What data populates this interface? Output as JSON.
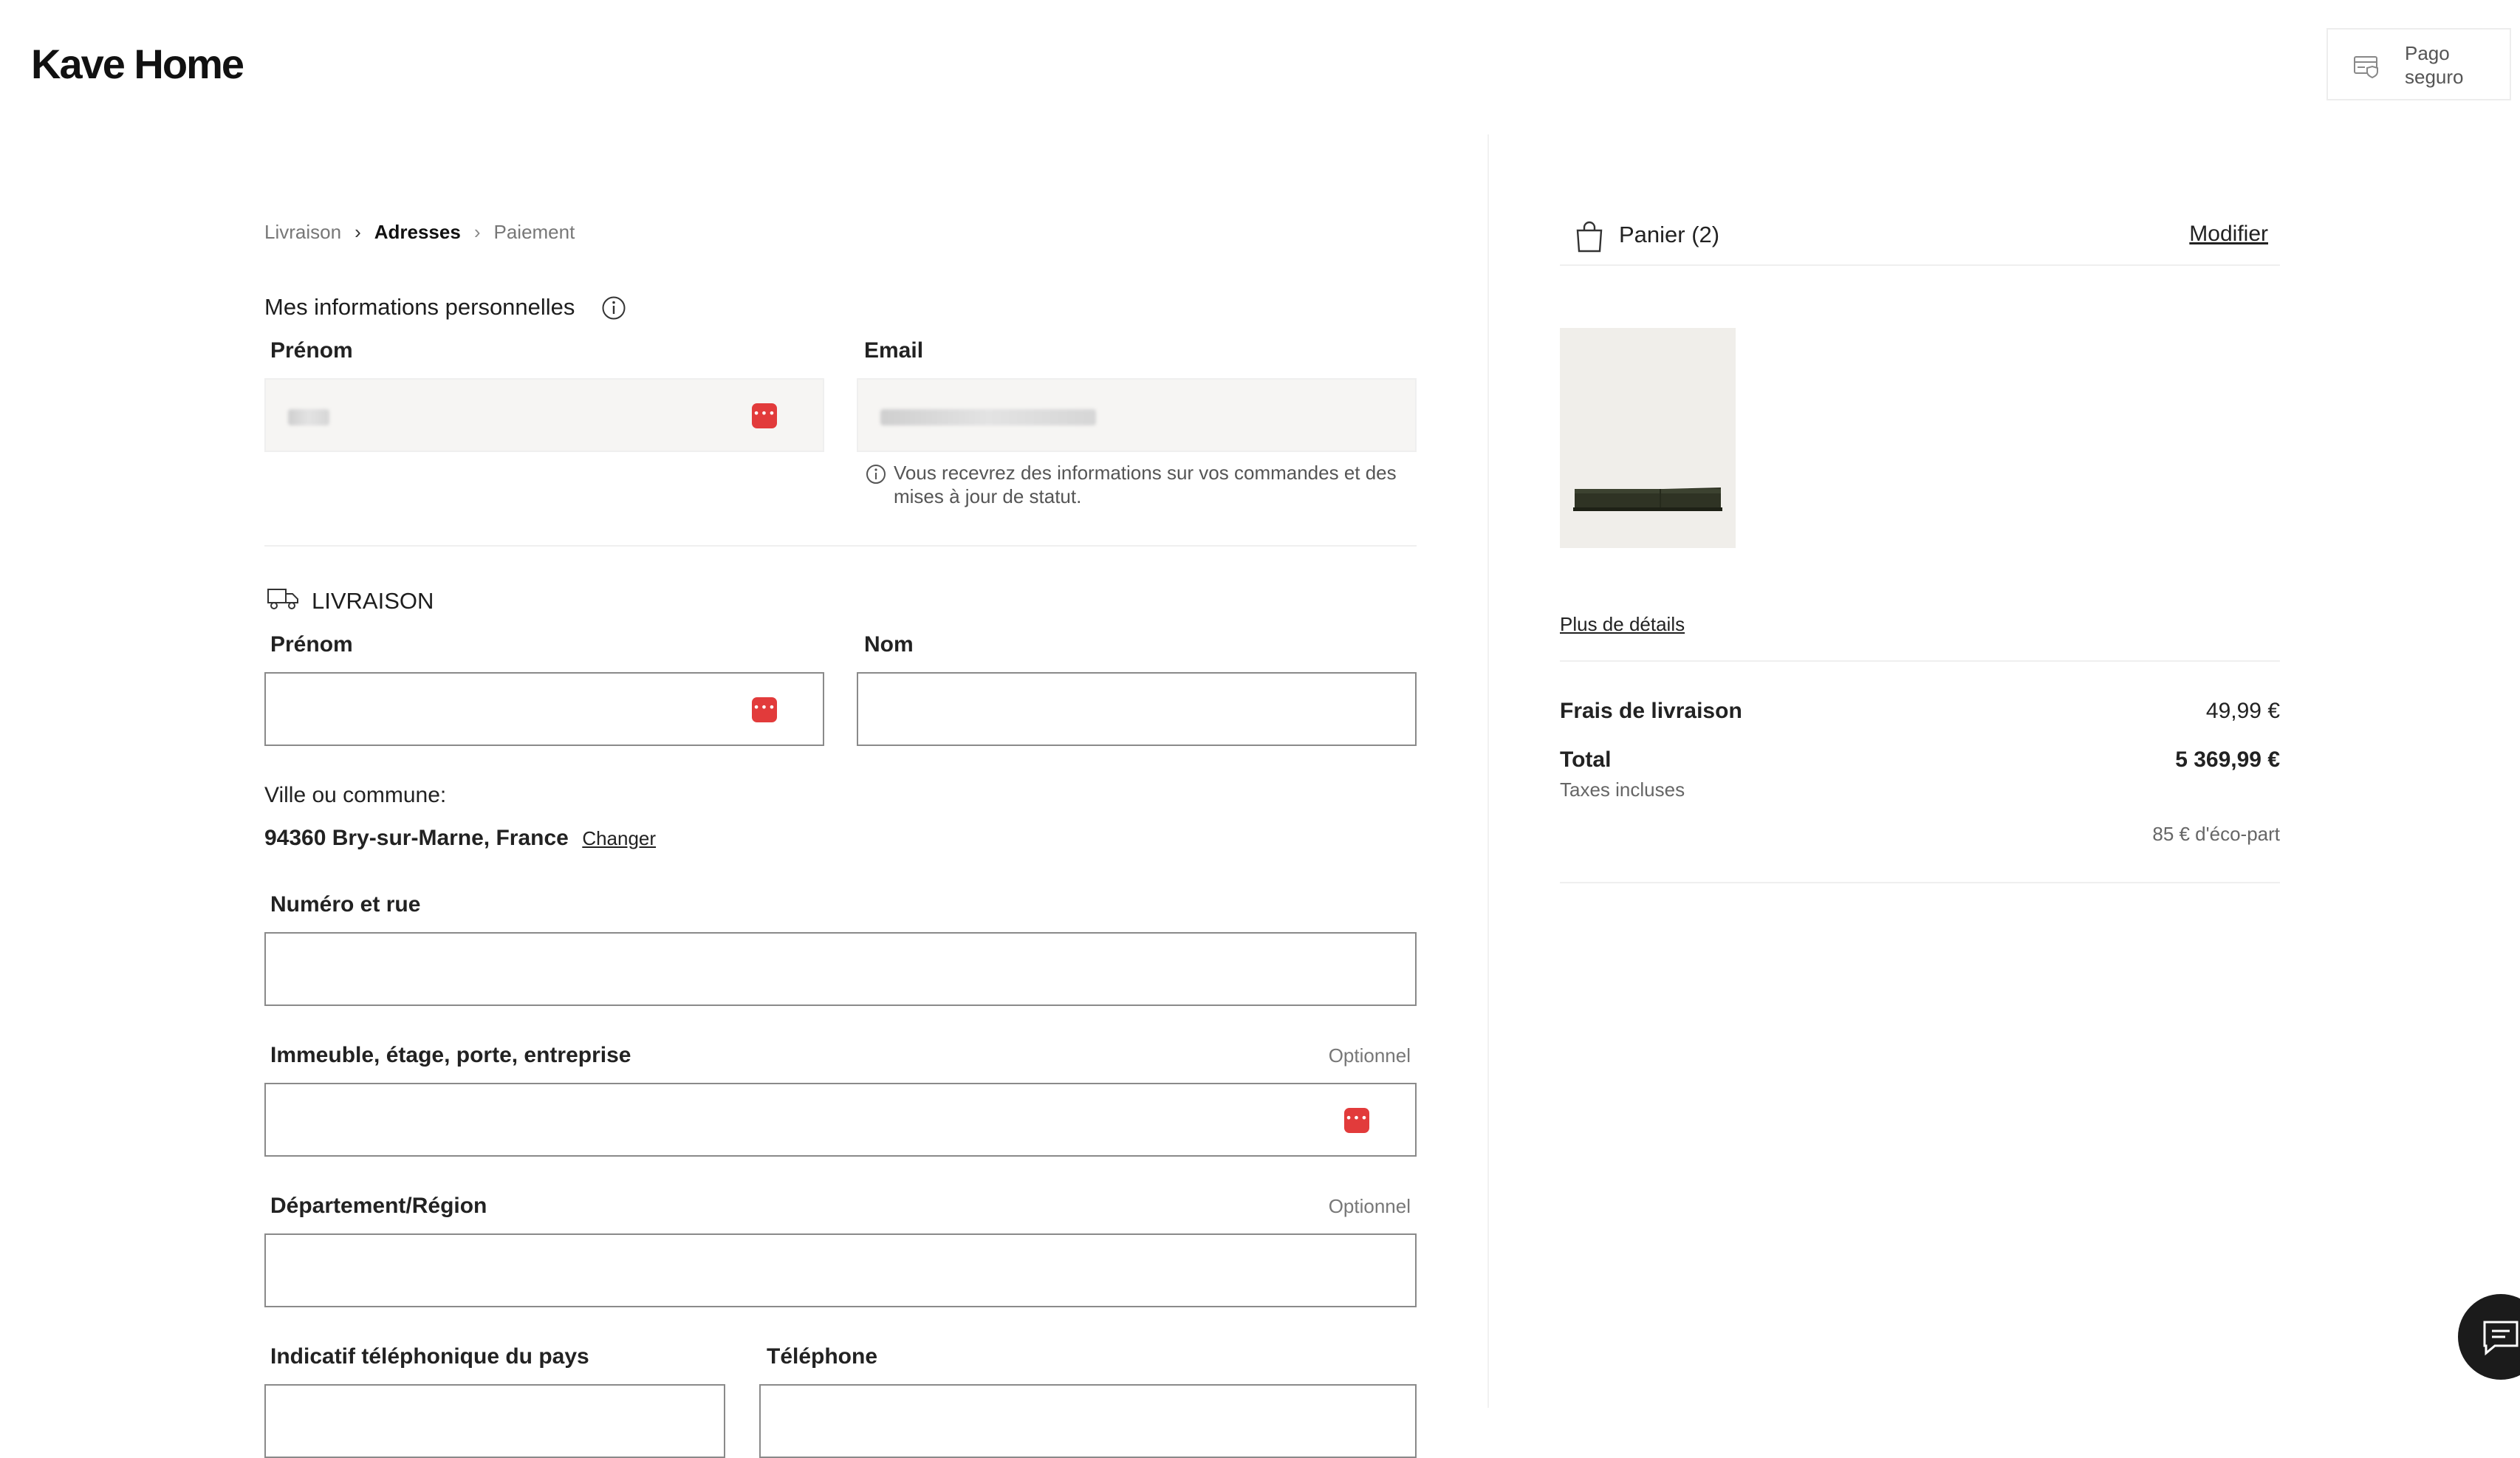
{
  "header": {
    "logo": "Kave Home",
    "secure_payment": "Pago seguro"
  },
  "breadcrumb": [
    {
      "label": "Livraison",
      "state": "done"
    },
    {
      "label": "Adresses",
      "state": "current"
    },
    {
      "label": "Paiement",
      "state": "upcoming"
    }
  ],
  "personal_info": {
    "title": "Mes informations personnelles",
    "first_name_label": "Prénom",
    "email_label": "Email",
    "email_hint": "Vous recevrez des informations sur vos commandes et des mises à jour de statut."
  },
  "delivery": {
    "title": "LIVRAISON",
    "first_name_label": "Prénom",
    "last_name_label": "Nom",
    "city_label": "Ville ou commune:",
    "city_value": "94360 Bry-sur-Marne, France",
    "change_link": "Changer",
    "street_label": "Numéro et rue",
    "building_label": "Immeuble, étage, porte, entreprise",
    "building_optional": "Optionnel",
    "region_label": "Département/Région",
    "region_optional": "Optionnel",
    "country_code_label": "Indicatif téléphonique du pays",
    "phone_label": "Téléphone"
  },
  "cart": {
    "title": "Panier (2)",
    "modify_link": "Modifier",
    "details_link": "Plus de détails",
    "shipping_label": "Frais de livraison",
    "shipping_value": "49,99 €",
    "total_label": "Total",
    "total_value": "5 369,99 €",
    "taxes_note": "Taxes incluses",
    "eco_part": "85 € d'éco-part"
  },
  "colors": {
    "accent_badge": "#e23b3b",
    "text": "#1c1c1c",
    "input_border": "#8a8a8a",
    "filled_input_bg": "#f6f5f3"
  }
}
